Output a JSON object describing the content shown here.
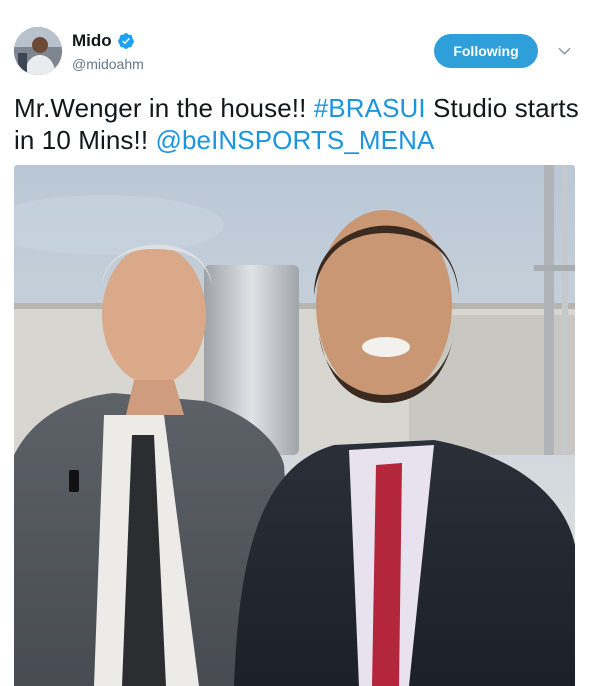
{
  "author": {
    "display_name": "Mido",
    "handle": "@midoahm",
    "verified": true
  },
  "follow_button": {
    "label": "Following"
  },
  "icons": {
    "verified": "verified-badge-icon",
    "caret": "chevron-down-icon"
  },
  "tweet": {
    "text_parts": {
      "p1": "Mr.Wenger in the house!! ",
      "hashtag": "#BRASUI",
      "p2": " Studio starts in 10 Mins!! ",
      "mention": "@beINSPORTS_MENA"
    }
  },
  "colors": {
    "accent": "#2e9fd8",
    "link": "#1b95e0",
    "name": "#14171a",
    "secondary": "#657786"
  }
}
